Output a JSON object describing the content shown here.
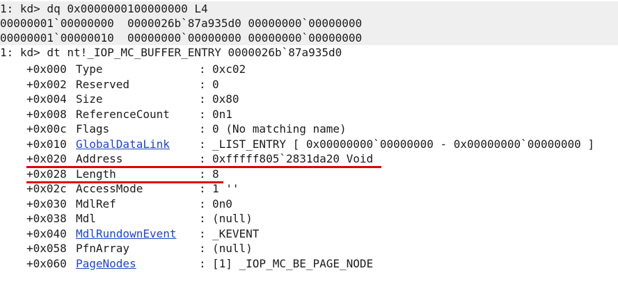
{
  "header_lines": [
    "1: kd> dq 0x0000000100000000 L4",
    "00000001`00000000  0000026b`87a935d0 00000000`00000000",
    "00000001`00000010  00000000`00000000 00000000`00000000",
    "1: kd> dt nt!_IOP_MC_BUFFER_ENTRY 0000026b`87a935d0"
  ],
  "fields": [
    {
      "offset": "+0x000",
      "name": "Type",
      "value": "0xc02",
      "link": false
    },
    {
      "offset": "+0x002",
      "name": "Reserved",
      "value": "0",
      "link": false
    },
    {
      "offset": "+0x004",
      "name": "Size",
      "value": "0x80",
      "link": false
    },
    {
      "offset": "+0x008",
      "name": "ReferenceCount",
      "value": "0n1",
      "link": false
    },
    {
      "offset": "+0x00c",
      "name": "Flags",
      "value": "0 (No matching name)",
      "link": false
    },
    {
      "offset": "+0x010",
      "name": "GlobalDataLink",
      "value": "_LIST_ENTRY [ 0x00000000`00000000 - 0x00000000`00000000 ]",
      "link": true
    },
    {
      "offset": "+0x020",
      "name": "Address",
      "value": "0xfffff805`2831da20 Void",
      "link": false
    },
    {
      "offset": "+0x028",
      "name": "Length",
      "value": "8",
      "link": false
    },
    {
      "offset": "+0x02c",
      "name": "AccessMode",
      "value": "1 ''",
      "link": false
    },
    {
      "offset": "+0x030",
      "name": "MdlRef",
      "value": "0n0",
      "link": false
    },
    {
      "offset": "+0x038",
      "name": "Mdl",
      "value": "(null)",
      "link": false
    },
    {
      "offset": "+0x040",
      "name": "MdlRundownEvent",
      "value": "_KEVENT",
      "link": true
    },
    {
      "offset": "+0x058",
      "name": "PfnArray",
      "value": "(null)",
      "link": false
    },
    {
      "offset": "+0x060",
      "name": "PageNodes",
      "value": "[1] _IOP_MC_BE_PAGE_NODE",
      "link": true
    }
  ],
  "colors": {
    "background": "#ffffff",
    "shade": "#efefef",
    "text": "#1b1b1b",
    "link": "#1f43c9",
    "highlight_underline": "#e00000"
  }
}
